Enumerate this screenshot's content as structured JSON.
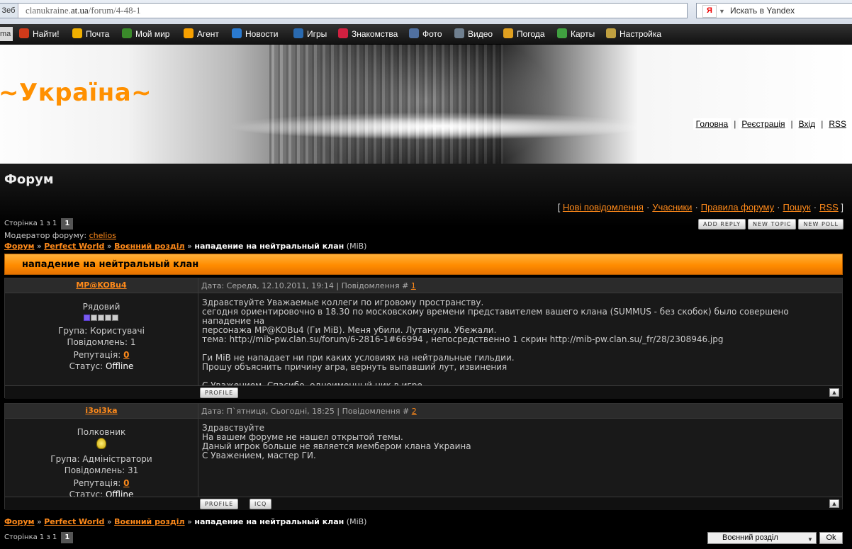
{
  "browser": {
    "address_prefix": "Зеб",
    "url_dim": "clanukraine.",
    "url_domain": "at.ua",
    "url_path": "/forum/4-48-1",
    "search_placeholder": "Искать в Yandex",
    "search_logo": "Я",
    "toolbar_left": "ma",
    "toolbar": [
      {
        "label": "Найти!",
        "icon": "opera-icon",
        "color": "#d03a1a"
      },
      {
        "label": "Почта",
        "icon": "mail-icon",
        "color": "#f0b000"
      },
      {
        "label": "Мой мир",
        "icon": "world-people-icon",
        "color": "#3a8a2a"
      },
      {
        "label": "Агент",
        "icon": "agent-at-icon",
        "color": "#f7a000"
      },
      {
        "label": "Новости",
        "icon": "globe-icon",
        "color": "#2a7ad0"
      },
      {
        "label": "Игры",
        "icon": "games-icon",
        "color": "#2a6ab0"
      },
      {
        "label": "Знакомства",
        "icon": "heart-icon",
        "color": "#d02040"
      },
      {
        "label": "Фото",
        "icon": "camera-icon",
        "color": "#5070a0"
      },
      {
        "label": "Видео",
        "icon": "video-icon",
        "color": "#708090"
      },
      {
        "label": "Погода",
        "icon": "weather-icon",
        "color": "#e0a020"
      },
      {
        "label": "Карты",
        "icon": "map-icon",
        "color": "#40a040"
      },
      {
        "label": "Настройка",
        "icon": "gear-icon",
        "color": "#c0a040"
      }
    ]
  },
  "site": {
    "title": "~Україна~",
    "nav": [
      "Головна",
      "Реєстрація",
      "Вхід",
      "RSS"
    ]
  },
  "forum": {
    "heading": "Форум",
    "links": [
      "Нові повідомлення",
      "Учасники",
      "Правила форуму",
      "Пошук",
      "RSS"
    ],
    "pager_label": "Сторінка 1 з 1",
    "page_num": "1",
    "moderator_label": "Модератор форуму:",
    "moderator_name": "chelios",
    "buttons": [
      "ADD REPLY",
      "NEW TOPIC",
      "NEW POLL"
    ],
    "breadcrumb": {
      "items": [
        "Форум",
        "Perfect World",
        "Воєнний розділ"
      ],
      "current": "нападение на нейтральный клан",
      "suffix": "(MiB)"
    }
  },
  "topic": {
    "title": "нападение на нейтральный клан"
  },
  "posts": [
    {
      "author": "MP@KOBu4",
      "date_text": "Дата: Середа, 12.10.2011, 19:14 | Повідомлення #",
      "num": "1",
      "rank": "Рядовий",
      "group": "Група: Користувачі",
      "count": "Повідомлень: 1",
      "rep_label": "Репутація:",
      "rep": "0",
      "status_label": "Статус:",
      "status": "Offline",
      "text": "Здравствуйте Уважаемые коллеги по игровому пространству.\nсегодня ориентировочно в 18.30 по московскому времени представителем вашего клана (SUMMUS - без скобок) было совершено нападение на\nперсонажа MP@KOBu4 (Ги MiB). Меня убили. Лутанули. Убежали.\nтема: http://mib-pw.clan.su/forum/6-2816-1#66994 , непосредственно 1 скрин http://mib-pw.clan.su/_fr/28/2308946.jpg\n\nГи MiB не нападает ни при каких условиях на нейтральные гильдии.\nПрошу объяснить причину агра, вернуть выпавший лут, извинения\n\nС Уважением, Спасибо, одноименный ник в игре",
      "buttons": [
        "PROFILE"
      ],
      "stars_on": 1
    },
    {
      "author": "i3oi3ka",
      "date_text": "Дата: П`ятниця, Сьогодні, 18:25 | Повідомлення #",
      "num": "2",
      "rank": "Полковник",
      "group": "Група: Адміністратори",
      "count": "Повідомлень: 31",
      "rep_label": "Репутація:",
      "rep": "0",
      "status_label": "Статус:",
      "status": "Offline",
      "text": "Здравствуйте\nНа вашем форуме не нашел открытой темы.\nДаный игрок больше не является мембером клана Украина\nС Уважением, мастер ГИ.",
      "buttons": [
        "PROFILE",
        "ICQ"
      ]
    }
  ],
  "footer": {
    "pager_label": "Сторінка 1 з 1",
    "page_num": "1",
    "jump_value": "Воєнний розділ",
    "ok": "Ok"
  }
}
